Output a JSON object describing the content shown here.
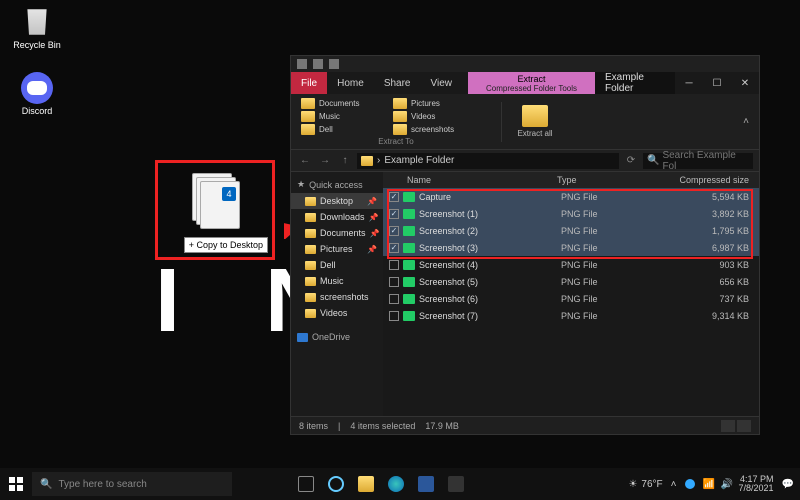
{
  "desktop": {
    "recycle_label": "Recycle Bin",
    "discord_label": "Discord",
    "watermark": "I N S"
  },
  "drag": {
    "count": "4",
    "tooltip": "+ Copy to Desktop"
  },
  "explorer": {
    "title": "Example Folder",
    "context_tab": "Extract",
    "context_sub": "Compressed Folder Tools",
    "tabs": {
      "file": "File",
      "home": "Home",
      "share": "Share",
      "view": "View"
    },
    "ribbon": {
      "dest": [
        "Documents",
        "Pictures",
        "Music",
        "Videos",
        "Dell",
        "screenshots"
      ],
      "section_label": "Extract To",
      "extract_all": "Extract all"
    },
    "breadcrumb": "Example Folder",
    "search_placeholder": "Search Example Fol",
    "nav": {
      "quick": "Quick access",
      "items": [
        "Desktop",
        "Downloads",
        "Documents",
        "Pictures",
        "Dell",
        "Music",
        "screenshots",
        "Videos"
      ],
      "onedrive": "OneDrive"
    },
    "columns": {
      "name": "Name",
      "type": "Type",
      "size": "Compressed size"
    },
    "rows": [
      {
        "sel": true,
        "name": "Capture",
        "type": "PNG File",
        "size": "5,594 KB"
      },
      {
        "sel": true,
        "name": "Screenshot (1)",
        "type": "PNG File",
        "size": "3,892 KB"
      },
      {
        "sel": true,
        "name": "Screenshot (2)",
        "type": "PNG File",
        "size": "1,795 KB"
      },
      {
        "sel": true,
        "name": "Screenshot (3)",
        "type": "PNG File",
        "size": "6,987 KB"
      },
      {
        "sel": false,
        "name": "Screenshot (4)",
        "type": "PNG File",
        "size": "903 KB"
      },
      {
        "sel": false,
        "name": "Screenshot (5)",
        "type": "PNG File",
        "size": "656 KB"
      },
      {
        "sel": false,
        "name": "Screenshot (6)",
        "type": "PNG File",
        "size": "737 KB"
      },
      {
        "sel": false,
        "name": "Screenshot (7)",
        "type": "PNG File",
        "size": "9,314 KB"
      }
    ],
    "status": {
      "count": "8 items",
      "selected": "4 items selected",
      "size": "17.9 MB"
    }
  },
  "taskbar": {
    "search_placeholder": "Type here to search",
    "weather_temp": "76°F",
    "time": "4:17 PM",
    "date": "7/8/2021"
  }
}
